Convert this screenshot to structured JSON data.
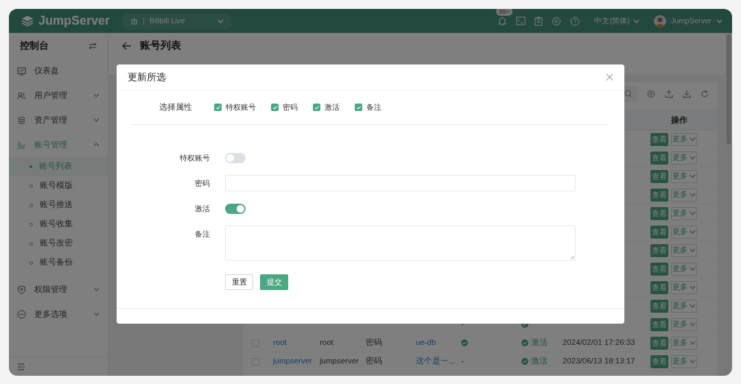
{
  "topbar": {
    "logo": "JumpServer",
    "org": "Bilibili Live",
    "badge": "99+",
    "language": "中文(简体)",
    "user": "JumpServer"
  },
  "sidebar": {
    "title": "控制台",
    "items": [
      {
        "label": "仪表盘",
        "selected": false
      },
      {
        "label": "用户管理",
        "selected": false,
        "expanded": false
      },
      {
        "label": "资产管理",
        "selected": false,
        "expanded": false
      },
      {
        "label": "账号管理",
        "selected": true,
        "expanded": true,
        "children": [
          {
            "label": "账号列表",
            "selected": true
          },
          {
            "label": "账号模版",
            "selected": false
          },
          {
            "label": "账号推送",
            "selected": false
          },
          {
            "label": "账号收集",
            "selected": false
          },
          {
            "label": "账号改密",
            "selected": false
          },
          {
            "label": "账号备份",
            "selected": false
          }
        ]
      },
      {
        "label": "权限管理",
        "selected": false,
        "expanded": false
      },
      {
        "label": "更多选项",
        "selected": false,
        "expanded": false
      }
    ]
  },
  "page": {
    "title": "账号列表"
  },
  "table": {
    "action_header": "操作",
    "rows": [
      {
        "view": "查看",
        "more": "更多"
      },
      {
        "view": "查看",
        "more": "更多"
      },
      {
        "view": "查看",
        "more": "更多"
      },
      {
        "view": "查看",
        "more": "更多"
      },
      {
        "view": "查看",
        "more": "更多"
      },
      {
        "view": "查看",
        "more": "更多"
      },
      {
        "view": "查看",
        "more": "更多"
      },
      {
        "view": "查看",
        "more": "更多"
      },
      {
        "view": "查看",
        "more": "更多"
      },
      {
        "view": "查看",
        "more": "更多"
      },
      {
        "column_5": {
          "kind": "text",
          "text": "-"
        },
        "status": {
          "active": true
        },
        "view": "查看",
        "more": "更多"
      },
      {
        "checked": false,
        "name": "root",
        "username": "root",
        "type": "密码",
        "asset": "ue-db",
        "column_5": {
          "kind": "check"
        },
        "status": {
          "label": "激活",
          "active": true
        },
        "date": "2024/02/01 17:26:33",
        "view": "查看",
        "more": "更多"
      },
      {
        "checked": false,
        "name": "jumpserver",
        "username": "jumpserver",
        "type": "密码",
        "asset": "这个是一...",
        "column_5": {
          "kind": "text",
          "text": "-"
        },
        "status": {
          "label": "激活",
          "active": true
        },
        "date": "2023/06/13 18:13:17",
        "view": "查看",
        "more": "更多"
      }
    ]
  },
  "modal": {
    "title": "更新所选",
    "attributes_label": "选择属性",
    "attributes": [
      {
        "label": "特权账号",
        "checked": true
      },
      {
        "label": "密码",
        "checked": true
      },
      {
        "label": "激活",
        "checked": true
      },
      {
        "label": "备注",
        "checked": true
      }
    ],
    "fields": [
      {
        "kind": "switch",
        "label": "特权账号",
        "on": false
      },
      {
        "kind": "input",
        "label": "密码"
      },
      {
        "kind": "switch",
        "label": "激活",
        "on": true
      },
      {
        "kind": "textarea",
        "label": "备注"
      }
    ],
    "buttons": [
      {
        "kind": "default",
        "label": "重置"
      },
      {
        "kind": "primary",
        "label": "提交"
      }
    ]
  }
}
